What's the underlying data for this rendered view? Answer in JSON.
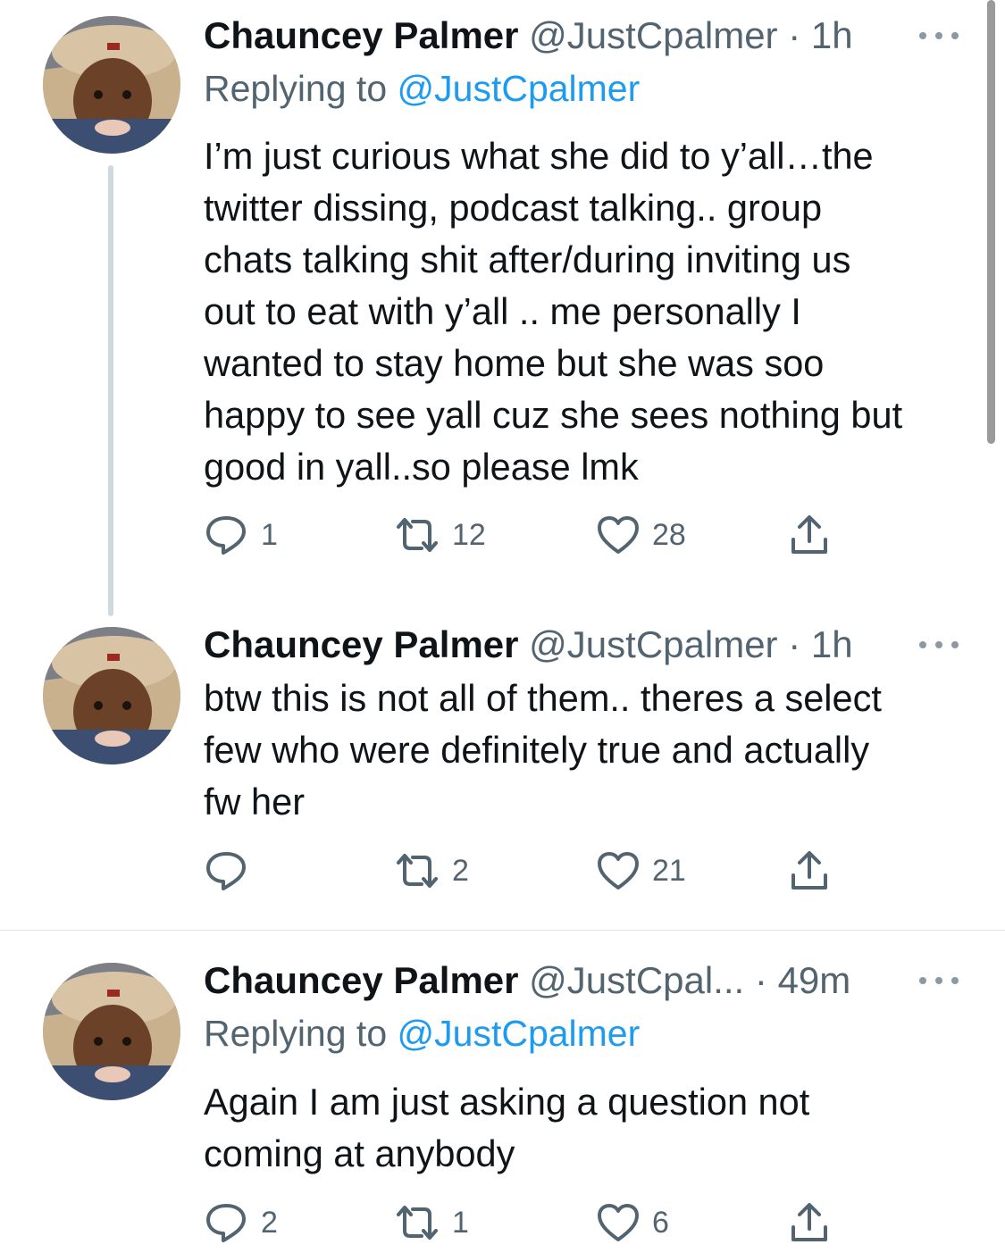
{
  "tweets": [
    {
      "name": "Chauncey Palmer",
      "handle": "@JustCpalmer",
      "separator": "·",
      "time": "1h",
      "replying_prefix": "Replying to ",
      "replying_handle": "@JustCpalmer",
      "text": "I’m just curious what she did to y’all…the\ntwitter dissing, podcast talking.. group\nchats talking shit after/during inviting us\nout to eat with y’all .. me personally I\nwanted to stay home but she was soo\nhappy to see yall cuz she sees nothing but\ngood in yall..so please lmk",
      "replies": "1",
      "retweets": "12",
      "likes": "28"
    },
    {
      "name": "Chauncey Palmer",
      "handle": "@JustCpalmer",
      "separator": "·",
      "time": "1h",
      "text": "btw this is not all of them.. theres a select\nfew who were definitely true and actually\nfw her",
      "replies": "",
      "retweets": "2",
      "likes": "21"
    },
    {
      "name": "Chauncey Palmer",
      "handle": "@JustCpal...",
      "separator": "·",
      "time": "49m",
      "replying_prefix": "Replying to ",
      "replying_handle": "@JustCpalmer",
      "text": "Again I am just asking a question not\ncoming at anybody",
      "replies": "2",
      "retweets": "1",
      "likes": "6"
    }
  ],
  "icons": {
    "reply": "reply-icon",
    "retweet": "retweet-icon",
    "like": "heart-icon",
    "share": "share-icon",
    "more": "more-icon"
  },
  "colors": {
    "text": "#0f1419",
    "secondary": "#536471",
    "link": "#1d9bf0",
    "thread_line": "#cfd9de"
  }
}
